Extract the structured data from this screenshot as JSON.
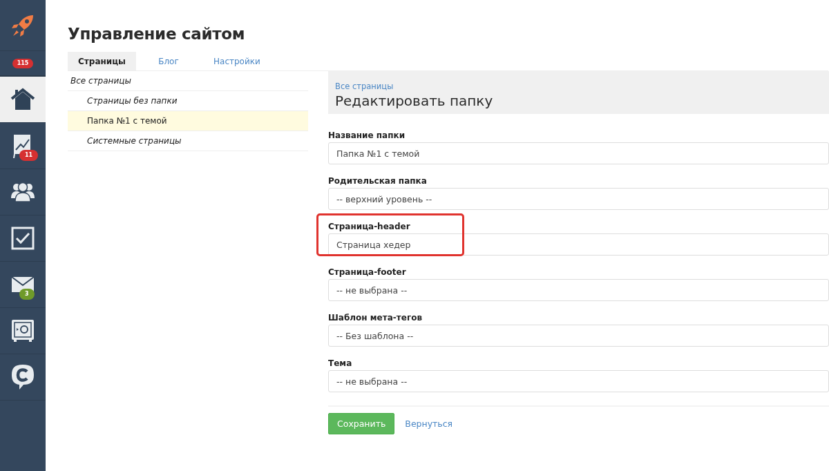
{
  "sidebar": {
    "top_badge": {
      "text": "115",
      "color": "#d63031"
    },
    "items": [
      {
        "selected": true
      },
      {
        "selected": false,
        "badge": "11",
        "color": "#d63031"
      },
      {
        "selected": false
      },
      {
        "selected": false
      },
      {
        "selected": false,
        "badge": "3",
        "color": "#6f9a2a"
      },
      {
        "selected": false
      },
      {
        "selected": false
      }
    ]
  },
  "page_title": "Управление сайтом",
  "tabs": [
    {
      "label": "Страницы",
      "selected": true
    },
    {
      "label": "Блог",
      "selected": false
    },
    {
      "label": "Настройки",
      "selected": false
    }
  ],
  "tree": {
    "label": "Все страницы",
    "children": [
      {
        "label": "Страницы без папки",
        "italic": true,
        "selected": false
      },
      {
        "label": "Папка №1 с темой",
        "italic": false,
        "selected": true
      },
      {
        "label": "Системные страницы",
        "italic": true,
        "selected": false
      }
    ]
  },
  "panel": {
    "breadcrumb": "Все страницы",
    "title": "Редактировать папку"
  },
  "fields": [
    {
      "label": "Название папки",
      "value": "Папка №1 с темой",
      "highlighted": false
    },
    {
      "label": "Родительская папка",
      "value": "-- верхний уровень --",
      "highlighted": false
    },
    {
      "label": "Страница-header",
      "value": "Страница хедер",
      "highlighted": true
    },
    {
      "label": "Страница-footer",
      "value": "-- не выбрана --",
      "highlighted": false
    },
    {
      "label": "Шаблон мета-тегов",
      "value": "-- Без шаблона --",
      "highlighted": false
    },
    {
      "label": "Тема",
      "value": "-- не выбрана --",
      "highlighted": false
    }
  ],
  "buttons": {
    "save": "Сохранить",
    "back": "Вернуться"
  }
}
